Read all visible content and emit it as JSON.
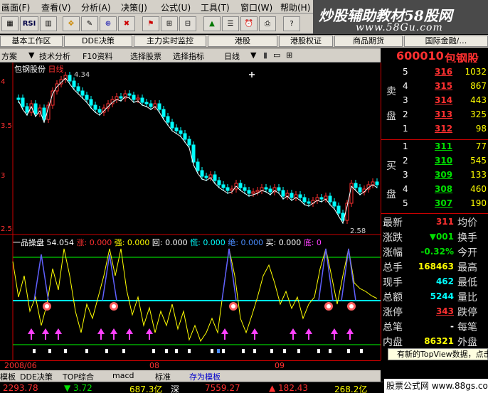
{
  "menu": [
    "画面(F)",
    "查看(V)",
    "分析(A)",
    "决策(J)",
    "公式(U)",
    "工具(T)",
    "窗口(W)",
    "帮助(H)"
  ],
  "banner": {
    "title": "炒股辅助教材58股网",
    "url": "www.58Gu.com"
  },
  "toolbar": {
    "rsi_label": "RSI"
  },
  "tabs_top": [
    "基本工作区",
    "DDE决策",
    "主力实时监控",
    "港股",
    "港股权证",
    "商品期货",
    "国际金融/…"
  ],
  "tabs_chart": [
    "方案",
    "技术分析",
    "F10资料",
    "选择股票",
    "选择指标",
    "日线"
  ],
  "stock": {
    "code": "600010",
    "name": "包钢股份",
    "tag": "包钢股份",
    "period": "日线",
    "high_label": "4.34",
    "low_label": "2.58"
  },
  "y_axis": [
    "4",
    "3.5",
    "3",
    "2.5"
  ],
  "indicator": {
    "name": "一品操盘",
    "v1": "54.054",
    "items": [
      {
        "k": "涨",
        "v": "0.000"
      },
      {
        "k": "强",
        "v": "0.000"
      },
      {
        "k": "回",
        "v": "0.000"
      },
      {
        "k": "慌",
        "v": "0.000"
      },
      {
        "k": "绝",
        "v": "0.000"
      },
      {
        "k": "买",
        "v": "0.000"
      },
      {
        "k": "底",
        "v": "0"
      }
    ]
  },
  "date_axis": {
    "left": "2008/06",
    "mid": "08",
    "right": "09"
  },
  "sell": [
    {
      "n": "5",
      "p": "316",
      "v": "1032"
    },
    {
      "n": "4",
      "p": "315",
      "v": "867"
    },
    {
      "n": "3",
      "p": "314",
      "v": "443"
    },
    {
      "n": "2",
      "p": "313",
      "v": "325"
    },
    {
      "n": "1",
      "p": "312",
      "v": "98"
    }
  ],
  "buy": [
    {
      "n": "1",
      "p": "311",
      "v": "77"
    },
    {
      "n": "2",
      "p": "310",
      "v": "545"
    },
    {
      "n": "3",
      "p": "309",
      "v": "133"
    },
    {
      "n": "4",
      "p": "308",
      "v": "460"
    },
    {
      "n": "5",
      "p": "307",
      "v": "190"
    }
  ],
  "sell_label": [
    "卖",
    "盘"
  ],
  "buy_label": [
    "买",
    "盘"
  ],
  "stats": [
    {
      "l": "最新",
      "v": "311",
      "r": "均价"
    },
    {
      "l": "涨跌",
      "v": "▼001",
      "r": "换手"
    },
    {
      "l": "涨幅",
      "v": "-0.32%",
      "r": "今开"
    },
    {
      "l": "总手",
      "v": "168463",
      "r": "最高"
    },
    {
      "l": "现手",
      "v": "462",
      "r": "最低"
    },
    {
      "l": "总额",
      "v": "5244",
      "r": "量比"
    },
    {
      "l": "涨停",
      "v": "343",
      "r": "跌停"
    },
    {
      "l": "总笔",
      "v": "-",
      "r": "每笔"
    },
    {
      "l": "内盘",
      "v": "86321",
      "r": "外盘"
    }
  ],
  "notice": "有新的TopView数据，点击",
  "bottom_tabs": [
    "模板",
    "DDE决策",
    "TOP综合",
    "macd",
    "标准",
    "存为模板"
  ],
  "bottom_bar": [
    "2293.78",
    "▼ 3.72",
    "687.3亿",
    "深",
    "7559.27",
    "▲ 182.43",
    "268.2亿"
  ],
  "watermark": "股票公式网 www.88gs.com",
  "colors": {
    "up": "#ff3030",
    "down": "#00ffff",
    "ma": "#ffffff"
  }
}
